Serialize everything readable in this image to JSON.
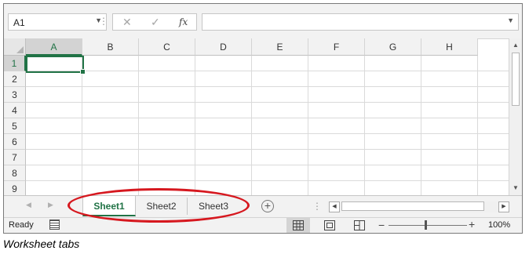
{
  "formula_bar": {
    "name_box": "A1",
    "separator": "⋮",
    "cancel_glyph": "✕",
    "enter_glyph": "✓",
    "fx_label": "fx",
    "formula_value": ""
  },
  "columns": [
    "A",
    "B",
    "C",
    "D",
    "E",
    "F",
    "G",
    "H"
  ],
  "rows": [
    "1",
    "2",
    "3",
    "4",
    "5",
    "6",
    "7",
    "8",
    "9"
  ],
  "active_cell": "A1",
  "sheets": [
    "Sheet1",
    "Sheet2",
    "Sheet3"
  ],
  "active_sheet": "Sheet1",
  "status": {
    "ready": "Ready",
    "zoom": "100%",
    "zoom_minus": "−",
    "zoom_plus": "+"
  },
  "caption": "Worksheet tabs",
  "colors": {
    "accent": "#217346",
    "annotation": "#d6181f"
  }
}
